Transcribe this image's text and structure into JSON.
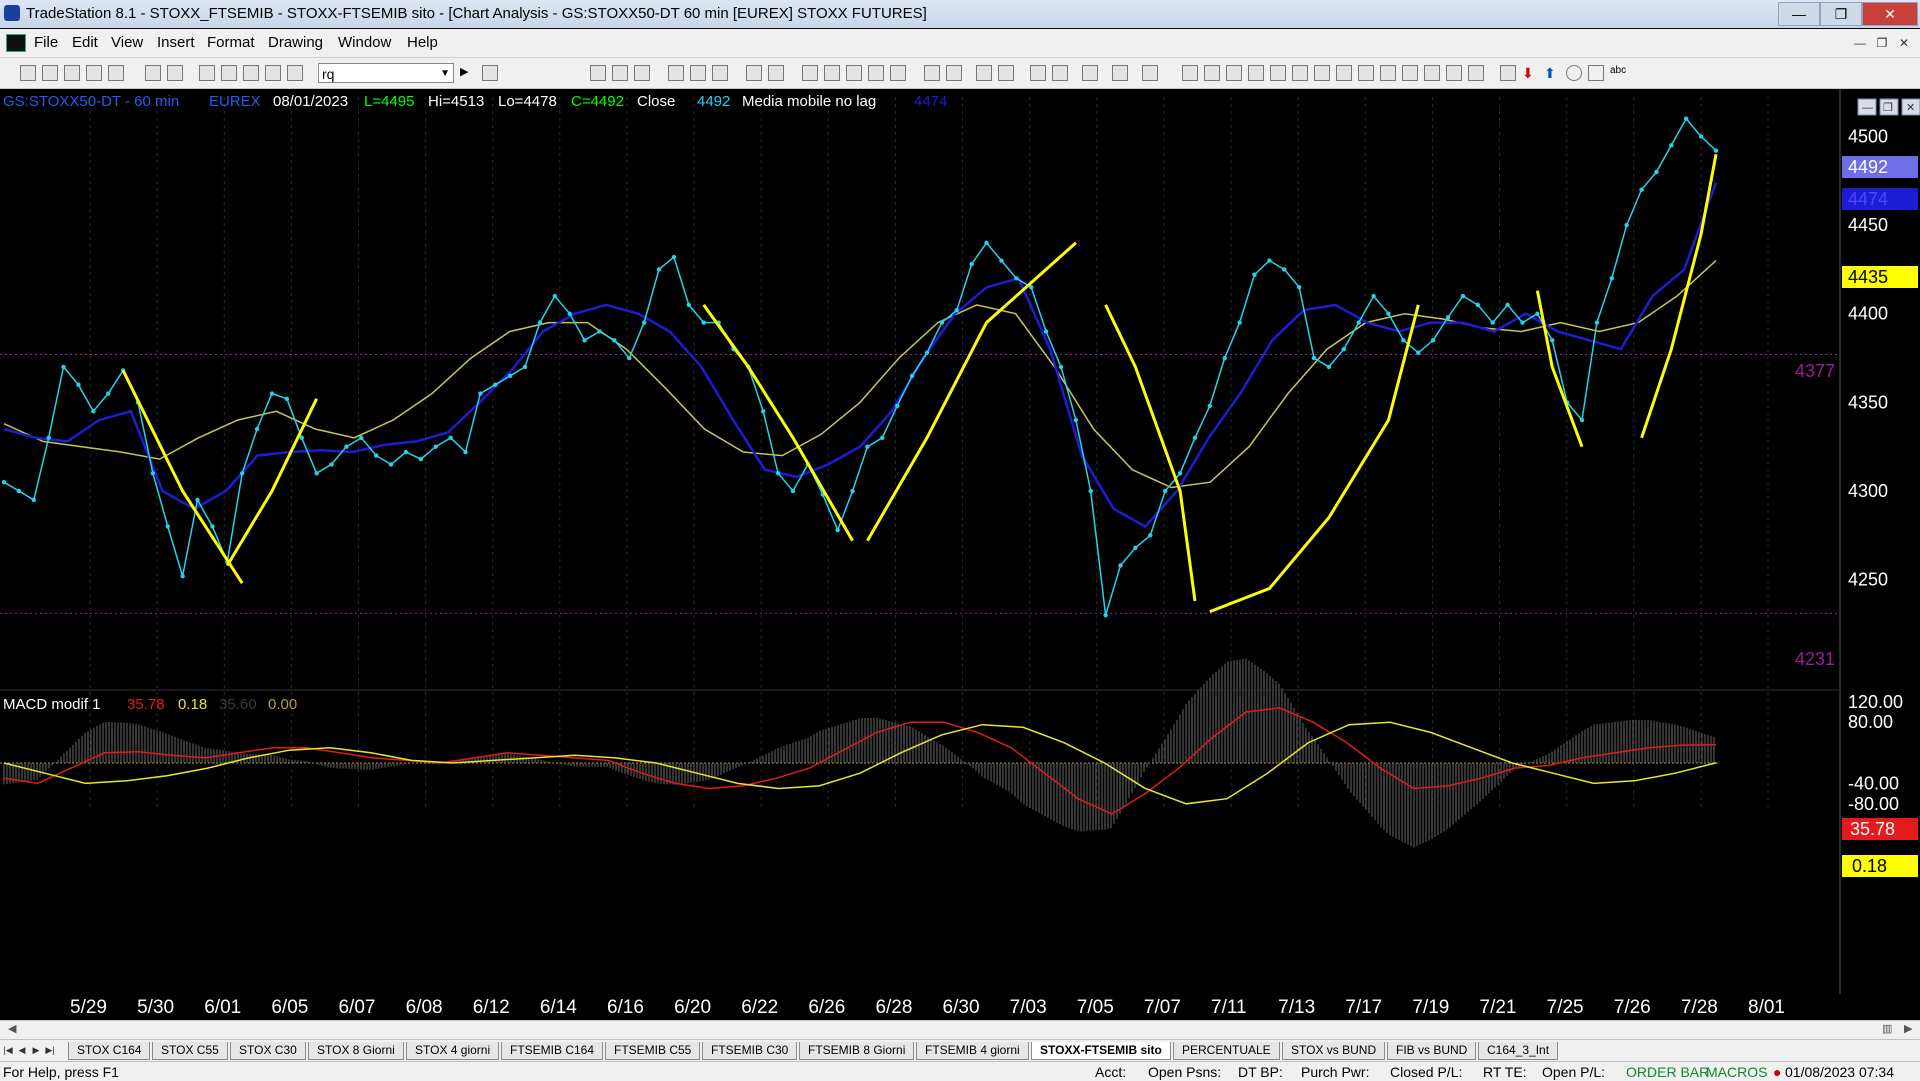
{
  "window": {
    "title": "TradeStation 8.1 - STOXX_FTSEMIB - STOXX-FTSEMIB sito - [Chart Analysis - GS:STOXX50-DT  60 min  [EUREX] STOXX FUTURES]",
    "min_glyph": "—",
    "max_glyph": "❐",
    "close_glyph": "✕"
  },
  "menu": {
    "items": [
      "File",
      "Edit",
      "View",
      "Insert",
      "Format",
      "Drawing",
      "Window",
      "Help"
    ]
  },
  "toolbar": {
    "symbol_value": "rq"
  },
  "header": {
    "symbol": "GS:STOXX50-DT - 60 min",
    "exchange": "EUREX",
    "date": "08/01/2023",
    "low": "L=4495",
    "high": "Hi=4513",
    "lo": "Lo=4478",
    "close": "C=4492",
    "close_label": "Close",
    "close_value": "4492",
    "ma_label": "Media mobile no lag",
    "ma_value": "4474"
  },
  "price_badges": {
    "close": "4492",
    "ma": "4474",
    "bid": "4435",
    "level_high": "4377",
    "level_low": "4231"
  },
  "macd": {
    "label": "MACD modif 1",
    "v1": "35.78",
    "v2": "0.18",
    "v3": "35.60",
    "v4": "0.00",
    "badge_red": "35.78",
    "badge_yellow": "0.18"
  },
  "colors": {
    "price": "#22d3ee",
    "ma_blue": "#1d1dd6",
    "ma_yellow": "#c8c84a",
    "drawn": "#ffff00",
    "macd_red": "#e41a1c",
    "macd_yellow": "#e8e82a",
    "level": "#9a1d9a"
  },
  "chart_data": {
    "type": "line",
    "title": "GS:STOXX50-DT - 60 min",
    "ylim": [
      4225,
      4520
    ],
    "yticks": [
      4250,
      4300,
      4350,
      4400,
      4450,
      4500
    ],
    "x_labels": [
      "5/29",
      "5/30",
      "6/01",
      "6/05",
      "6/07",
      "6/08",
      "6/12",
      "6/14",
      "6/16",
      "6/20",
      "6/22",
      "6/26",
      "6/28",
      "6/30",
      "7/03",
      "7/05",
      "7/07",
      "7/11",
      "7/13",
      "7/17",
      "7/19",
      "7/21",
      "7/25",
      "7/26",
      "7/28",
      "8/01"
    ],
    "series": [
      {
        "values": [
          4305,
          4300,
          4295,
          4330,
          4370,
          4360,
          4345,
          4355,
          4368,
          4350,
          4310,
          4280,
          4252,
          4295,
          4280,
          4260,
          4310,
          4335,
          4355,
          4352,
          4330,
          4310,
          4315,
          4325,
          4330,
          4320,
          4315,
          4322,
          4318,
          4325,
          4330,
          4322,
          4355,
          4360,
          4365,
          4370,
          4395,
          4410,
          4400,
          4385,
          4390,
          4385,
          4375,
          4395,
          4425,
          4432,
          4405,
          4395,
          4395,
          4380,
          4370,
          4345,
          4310,
          4300,
          4315,
          4298,
          4278,
          4300,
          4325,
          4330,
          4348,
          4365,
          4378,
          4395,
          4402,
          4428,
          4440,
          4430,
          4420,
          4415,
          4390,
          4370,
          4340,
          4300,
          4230,
          4258,
          4268,
          4275,
          4300,
          4310,
          4330,
          4348,
          4375,
          4395,
          4422,
          4430,
          4425,
          4415,
          4375,
          4370,
          4380,
          4395,
          4410,
          4400,
          4385,
          4378,
          4385,
          4398,
          4410,
          4405,
          4395,
          4405,
          4395,
          4400,
          4385,
          4350,
          4340,
          4395,
          4420,
          4450,
          4470,
          4480,
          4495,
          4510,
          4500,
          4492
        ],
        "color": "#22d3ee"
      },
      {
        "values": [
          4335,
          4330,
          4328,
          4340,
          4345,
          4300,
          4290,
          4300,
          4320,
          4322,
          4323,
          4322,
          4326,
          4328,
          4333,
          4350,
          4368,
          4390,
          4400,
          4405,
          4400,
          4390,
          4370,
          4340,
          4312,
          4308,
          4315,
          4325,
          4345,
          4375,
          4400,
          4415,
          4420,
          4380,
          4320,
          4290,
          4280,
          4300,
          4330,
          4355,
          4385,
          4402,
          4405,
          4395,
          4390,
          4395,
          4395,
          4390,
          4400,
          4390,
          4385,
          4380,
          4410,
          4425,
          4474
        ],
        "color": "#1d1dd6"
      },
      {
        "values": [
          4338,
          4328,
          4325,
          4322,
          4318,
          4330,
          4340,
          4345,
          4335,
          4330,
          4340,
          4355,
          4375,
          4390,
          4395,
          4395,
          4380,
          4358,
          4335,
          4322,
          4320,
          4332,
          4350,
          4375,
          4395,
          4405,
          4400,
          4370,
          4335,
          4312,
          4302,
          4305,
          4325,
          4355,
          4380,
          4395,
          4400,
          4397,
          4392,
          4390,
          4395,
          4390,
          4395,
          4410,
          4430
        ],
        "color": "#c8c84a"
      }
    ],
    "drawn_segments_count": 12,
    "macd_ylim": [
      -100,
      145
    ],
    "macd_yticks": [
      "120.00",
      "80.00",
      "-40.00",
      "-80.00"
    ],
    "macd_series": [
      {
        "values": [
          -30,
          -40,
          -10,
          20,
          22,
          15,
          10,
          20,
          30,
          30,
          20,
          10,
          5,
          0,
          10,
          20,
          15,
          10,
          5,
          -20,
          -40,
          -50,
          -45,
          -30,
          -10,
          25,
          60,
          80,
          80,
          60,
          30,
          -20,
          -70,
          -100,
          -60,
          -10,
          50,
          100,
          108,
          80,
          40,
          -10,
          -50,
          -45,
          -30,
          -10,
          -5,
          10,
          20,
          30,
          35,
          35.78
        ],
        "color": "#e41a1c"
      },
      {
        "values": [
          0,
          -20,
          -40,
          -35,
          -25,
          -10,
          10,
          25,
          30,
          20,
          5,
          0,
          5,
          10,
          15,
          10,
          0,
          -20,
          -40,
          -50,
          -45,
          -20,
          20,
          55,
          75,
          70,
          40,
          0,
          -50,
          -80,
          -70,
          -20,
          40,
          75,
          80,
          60,
          30,
          0,
          -20,
          -40,
          -35,
          -20,
          0.18
        ],
        "color": "#e8e82a"
      }
    ]
  },
  "tabs": [
    "STOX C164",
    "STOX C55",
    "STOX  C30",
    "STOX  8 Giorni",
    "STOX 4 giorni",
    "FTSEMIB C164",
    "FTSEMIB C55",
    "FTSEMIB C30",
    "FTSEMIB  8 Giorni",
    "FTSEMIB  4 giorni",
    "STOXX-FTSEMIB sito",
    "PERCENTUALE",
    "STOX vs BUND",
    "FIB vs BUND",
    "C164_3_Int"
  ],
  "active_tab": "STOXX-FTSEMIB sito",
  "status": {
    "help": "For Help, press F1",
    "acct": "Acct:",
    "open_psns": "Open Psns:",
    "dt_bp": "DT BP:",
    "purch_pwr": "Purch Pwr:",
    "closed_pl": "Closed P/L:",
    "rt_te": "RT TE:",
    "open_pl": "Open P/L:",
    "order_bar": "ORDER BAR",
    "macros": "MACROS",
    "datetime": "01/08/2023 07:34"
  }
}
